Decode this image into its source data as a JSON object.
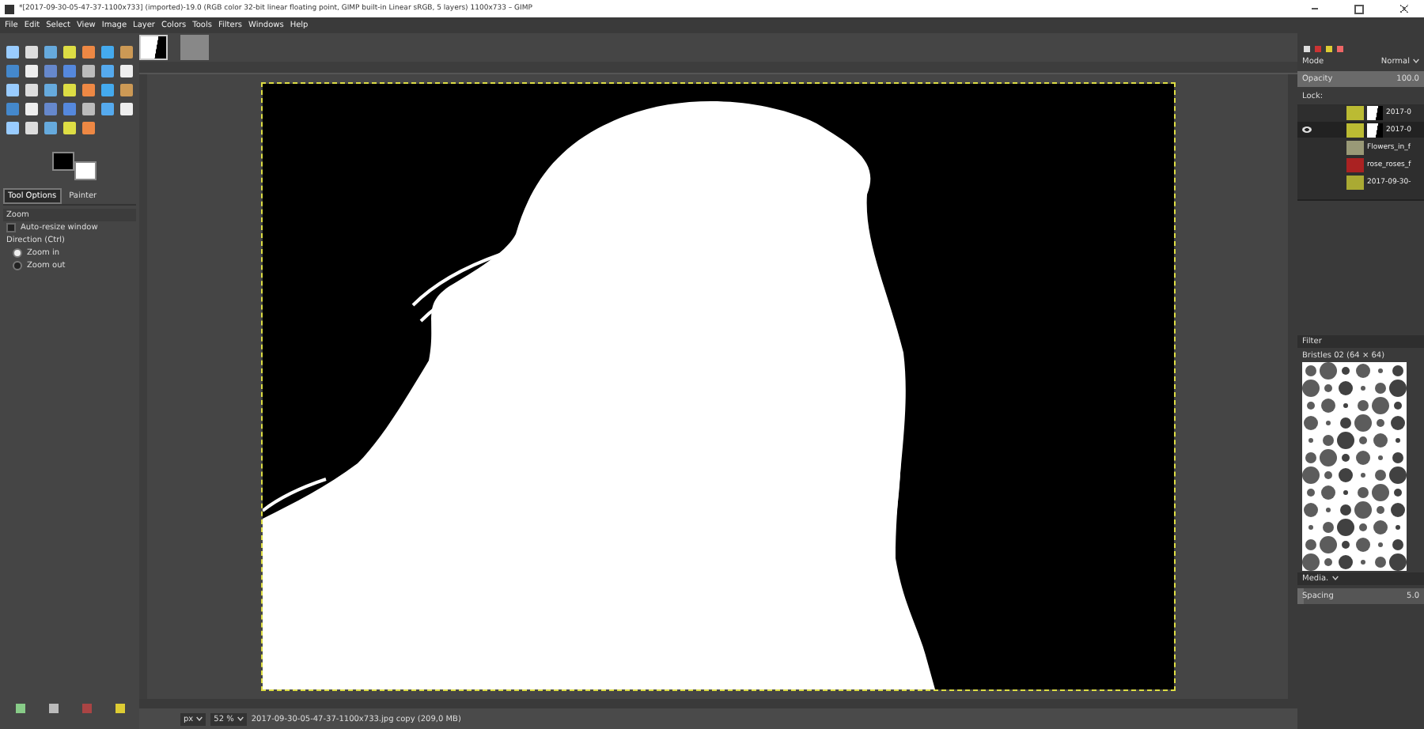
{
  "window": {
    "title": "*[2017-09-30-05-47-37-1100x733] (imported)-19.0 (RGB color 32-bit linear floating point, GIMP built-in Linear sRGB, 5 layers) 1100x733 – GIMP"
  },
  "menu": [
    "File",
    "Edit",
    "Select",
    "View",
    "Image",
    "Layer",
    "Colors",
    "Tools",
    "Filters",
    "Windows",
    "Help"
  ],
  "image_tabs": [
    {
      "kind": "mask",
      "selected": true
    },
    {
      "kind": "photo",
      "selected": false
    }
  ],
  "tool_options": {
    "tabs": [
      {
        "label": "Tool Options",
        "selected": true
      },
      {
        "label": "Painter",
        "selected": false
      }
    ],
    "title": "Zoom",
    "auto_resize": {
      "label": "Auto-resize window",
      "checked": false
    },
    "direction_label": "Direction  (Ctrl)",
    "directions": [
      {
        "label": "Zoom in",
        "selected": true
      },
      {
        "label": "Zoom out",
        "selected": false
      }
    ]
  },
  "layers": {
    "mode_label": "Mode",
    "mode": "Normal",
    "opacity": {
      "label": "Opacity",
      "value": "100.0",
      "level": 1
    },
    "lock_label": "Lock:",
    "items": [
      {
        "name": "2017-0",
        "mask": true,
        "visible": false,
        "selected": false
      },
      {
        "name": "2017-0",
        "mask": true,
        "visible": true,
        "selected": true
      },
      {
        "name": "Flowers_in_f",
        "mask": false,
        "visible": false,
        "selected": false
      },
      {
        "name": "rose_roses_f",
        "mask": false,
        "visible": false,
        "selected": false
      },
      {
        "name": "2017-09-30-",
        "mask": false,
        "visible": false,
        "selected": false
      }
    ]
  },
  "brushes": {
    "filter": "Filter",
    "title": "Bristles 02 (64 × 64)",
    "category": "Media.",
    "spacing": {
      "label": "Spacing",
      "value": "5.0",
      "level": 0.05
    }
  },
  "status_bar": {
    "unit": "px",
    "zoom": "52 %",
    "message": "2017-09-30-05-47-37-1100x733.jpg copy (209,0 MB)"
  }
}
